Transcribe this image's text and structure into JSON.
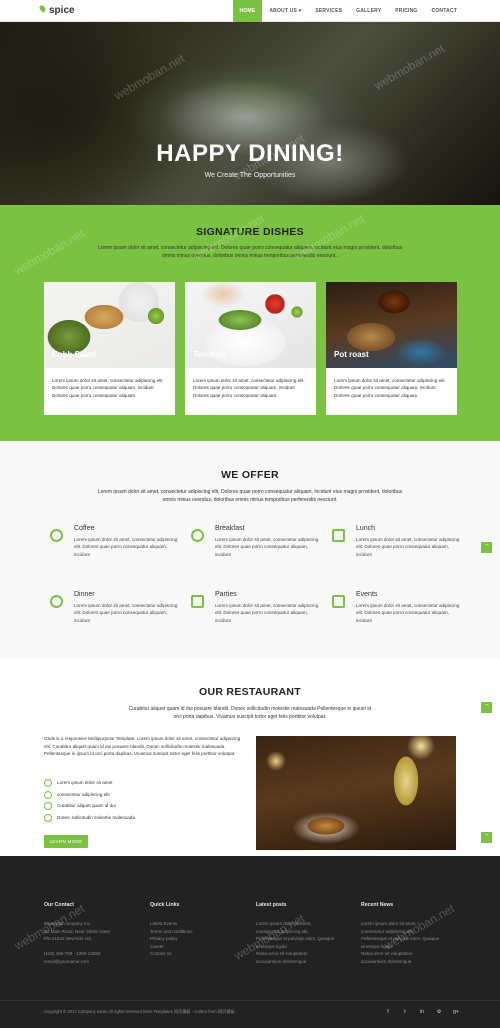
{
  "nav": {
    "logo": "spice",
    "items": [
      {
        "label": "HOME",
        "active": true
      },
      {
        "label": "ABOUT US ▾",
        "active": false
      },
      {
        "label": "SERVICES",
        "active": false
      },
      {
        "label": "GALLERY",
        "active": false
      },
      {
        "label": "PRICING",
        "active": false
      },
      {
        "label": "CONTACT",
        "active": false
      }
    ]
  },
  "hero": {
    "title": "HAPPY DINING!",
    "subtitle": "We Create The Opportunities"
  },
  "signature": {
    "title": "SIGNATURE DISHES",
    "desc": "Lorem ipsum dolor sit amet, consectetur adipiscing elit. Dolores quae porro consequatur aliquam, incidunt eius magni provident, doloribus omnis minus ovendus, doloribus omnis minus temporibus perferendis nesciunt..",
    "cards": [
      {
        "name": "Cobb Salad",
        "text": "Lorem ipsum dolor sit amet, consectetur adipiscing elit. Dolores quae porro consequatur aliquam, incidunt Dolores quae porro consequatur aliquam."
      },
      {
        "name": "Twinkies",
        "text": "Lorem ipsum dolor sit amet, consectetur adipiscing elit. Dolores quae porro consequatur aliquam, incidunt Dolores quae porro consequatur aliquam."
      },
      {
        "name": "Pot roast",
        "text": "Lorem ipsum dolor sit amet, consectetur adipiscing elit. Dolores quae porro consequatur aliquam, incidunt Dolores quae porro consequatur aliquam."
      }
    ]
  },
  "offer": {
    "title": "WE OFFER",
    "desc": "Lorem ipsum dolor sit amet, consectetur adipiscing elit. Dolores quae porro consequatur aliquam, incidunt eius magni provident, doloribus omnis minus ovendus, doloribus omnis minus temporibus perferendis nesciunt.",
    "items": [
      {
        "name": "Coffee",
        "text": "Lorem ipsum dolor sit amet, consectetur adipiscing elit. Dolores quae porro consequatur aliquam, incidunt"
      },
      {
        "name": "Breakfast",
        "text": "Lorem ipsum dolor sit amet, consectetur adipiscing elit. Dolores quae porro consequatur aliquam, incidunt"
      },
      {
        "name": "Lunch",
        "text": "Lorem ipsum dolor sit amet, consectetur adipiscing elit. Dolores quae porro consequatur aliquam, incidunt"
      },
      {
        "name": "Dinner",
        "text": "Lorem ipsum dolor sit amet, consectetur adipiscing elit. Dolores quae porro consequatur aliquam, incidunt"
      },
      {
        "name": "Parties",
        "text": "Lorem ipsum dolor sit amet, consectetur adipiscing elit. Dolores quae porro consequatur aliquam, incidunt"
      },
      {
        "name": "Events",
        "text": "Lorem ipsum dolor sit amet, consectetur adipiscing elit. Dolores quae porro consequatur aliquam, incidunt"
      }
    ]
  },
  "restaurant": {
    "title": "OUR RESTAURANT",
    "desc": "Curabitur aliquet quam id dui posuere blandit. Donec sollicitudin molestie malesuada Pellentesque in ipsum id orci porta dapibus. Vivamus suscipit tortor eget felis porttitor volutpat.",
    "text": "Grids is a responsive Multipurpose Template. Lorem ipsum dolor sit amet, consectetur adipiscing elit. Curabitur aliquet quam id dui posuere blandit. Donec sollicitudin molestie malesuada. Pellentesque in ipsum id orci porta dapibus. Vivamus suscipit tortor eget felis porttitor volutpat.",
    "list": [
      "Lorem ipsum dolor sit amet",
      "consectetur adipiscing elit",
      "Curabitur aliquet quam id dui",
      "Donec sollicitudin molestie malesuada."
    ],
    "button": "LEARN MORE"
  },
  "footer": {
    "contact": {
      "title": "Our Contact",
      "lines": [
        "Bootstrap company Inc.",
        "JC Main Road, Near Silnile tower",
        "Pin-21542 NewYork US.",
        "",
        "(123) 456-789 - 1255-12584",
        "email@yourname.com"
      ]
    },
    "links": {
      "title": "Quick Links",
      "lines": [
        "Latest Events",
        "Terms and conditions",
        "Privacy policy",
        "Career",
        "Contact us"
      ]
    },
    "posts": {
      "title": "Latest posts",
      "lines": [
        "Lorem ipsum dolor sit amet,",
        "consectetur adipiscing elit.",
        "Pellentesque et pulvinar enim. Quisque",
        "at tempor ligula",
        "Natus error sit voluptatem",
        "accusantium doloremque"
      ]
    },
    "news": {
      "title": "Recent News",
      "lines": [
        "Lorem ipsum dolor sit amet,",
        "consectetur adipiscing elit.",
        "Pellentesque et pulvinar enim. Quisque",
        "at tempor ligula",
        "Natus error sit voluptatem",
        "accusantium doloremque"
      ]
    },
    "copyright": "Copyright © 2017.Company name All rights reserved.More Templates 网页模板 - Collect from 网页模板",
    "socials": [
      "f",
      "t",
      "in",
      "⚙",
      "g+"
    ]
  },
  "watermark": "webmoban.net",
  "colors": {
    "accent": "#7cc242",
    "footer": "#222222"
  }
}
